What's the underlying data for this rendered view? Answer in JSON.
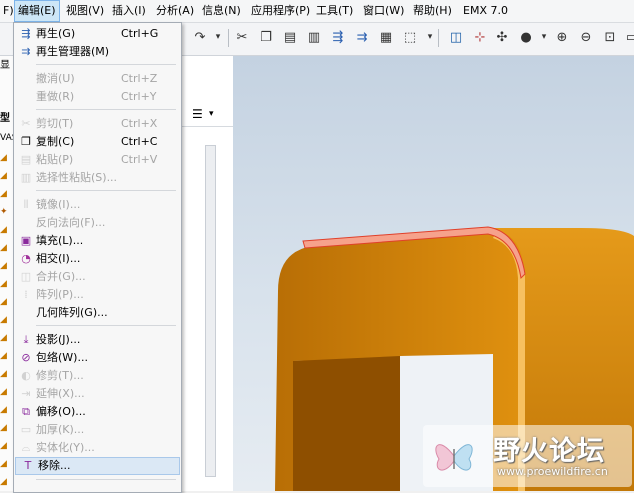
{
  "menubar": {
    "items": [
      {
        "label": "F)"
      },
      {
        "label": "编辑(E)"
      },
      {
        "label": "视图(V)"
      },
      {
        "label": "插入(I)"
      },
      {
        "label": "分析(A)"
      },
      {
        "label": "信息(N)"
      },
      {
        "label": "应用程序(P)"
      },
      {
        "label": "工具(T)"
      },
      {
        "label": "窗口(W)"
      },
      {
        "label": "帮助(H)"
      },
      {
        "label": "EMX 7.0"
      }
    ]
  },
  "left_panel": {
    "fragments": [
      "显",
      "型",
      "VAS"
    ]
  },
  "edit_menu": {
    "items": [
      {
        "label": "再生(G)",
        "shortcut": "Ctrl+G",
        "icon": "regenerate-icon"
      },
      {
        "label": "再生管理器(M)",
        "shortcut": "",
        "icon": "regen-manager-icon"
      },
      {
        "label": "撤消(U)",
        "shortcut": "Ctrl+Z",
        "icon": ""
      },
      {
        "label": "重做(R)",
        "shortcut": "Ctrl+Y",
        "icon": ""
      },
      {
        "label": "剪切(T)",
        "shortcut": "Ctrl+X",
        "icon": "scissors-icon"
      },
      {
        "label": "复制(C)",
        "shortcut": "Ctrl+C",
        "icon": "copy-icon"
      },
      {
        "label": "粘贴(P)",
        "shortcut": "Ctrl+V",
        "icon": "paste-icon"
      },
      {
        "label": "选择性粘贴(S)...",
        "shortcut": "",
        "icon": "paste-special-icon"
      },
      {
        "label": "镜像(I)...",
        "shortcut": "",
        "icon": "mirror-icon"
      },
      {
        "label": "反向法向(F)...",
        "shortcut": "",
        "icon": ""
      },
      {
        "label": "填充(L)...",
        "shortcut": "",
        "icon": "fill-icon"
      },
      {
        "label": "相交(I)...",
        "shortcut": "",
        "icon": "intersect-icon"
      },
      {
        "label": "合并(G)...",
        "shortcut": "",
        "icon": "merge-icon"
      },
      {
        "label": "阵列(P)...",
        "shortcut": "",
        "icon": "pattern-icon"
      },
      {
        "label": "几何阵列(G)...",
        "shortcut": "",
        "icon": ""
      },
      {
        "label": "投影(J)...",
        "shortcut": "",
        "icon": "project-icon"
      },
      {
        "label": "包络(W)...",
        "shortcut": "",
        "icon": "wrap-icon"
      },
      {
        "label": "修剪(T)...",
        "shortcut": "",
        "icon": "trim-icon"
      },
      {
        "label": "延伸(X)...",
        "shortcut": "",
        "icon": "extend-icon"
      },
      {
        "label": "偏移(O)...",
        "shortcut": "",
        "icon": "offset-icon"
      },
      {
        "label": "加厚(K)...",
        "shortcut": "",
        "icon": "thicken-icon"
      },
      {
        "label": "实体化(Y)...",
        "shortcut": "",
        "icon": "solidify-icon"
      },
      {
        "label": "移除...",
        "shortcut": "",
        "icon": "remove-icon"
      }
    ]
  },
  "watermark": {
    "title": "野火论坛",
    "url": "www.proewildfire.cn"
  }
}
